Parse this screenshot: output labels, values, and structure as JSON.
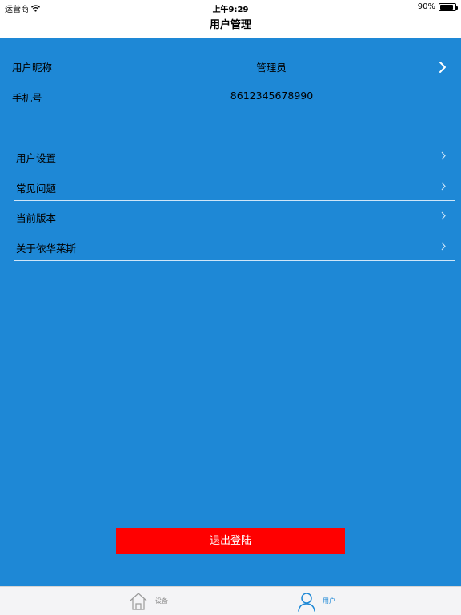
{
  "status_bar": {
    "carrier": "运营商",
    "time": "上午9:29",
    "battery": "90%",
    "battery_level": 0.9
  },
  "nav": {
    "title": "用户管理"
  },
  "profile": {
    "nickname_label": "用户昵称",
    "nickname_value": "管理员",
    "phone_label": "手机号",
    "phone_value": "8612345678990"
  },
  "menu": {
    "items": [
      {
        "label": "用户设置"
      },
      {
        "label": "常见问题"
      },
      {
        "label": "当前版本"
      },
      {
        "label": "关于依华莱斯"
      }
    ]
  },
  "logout": {
    "label": "退出登陆"
  },
  "tabs": {
    "items": [
      {
        "label": "设备",
        "icon": "home-icon",
        "selected": false
      },
      {
        "label": "用户",
        "icon": "user-icon",
        "selected": true
      }
    ]
  },
  "colors": {
    "content_bg": "#1e88d6",
    "logout_bg": "#ff0000",
    "active_tab": "#1e88d6"
  }
}
